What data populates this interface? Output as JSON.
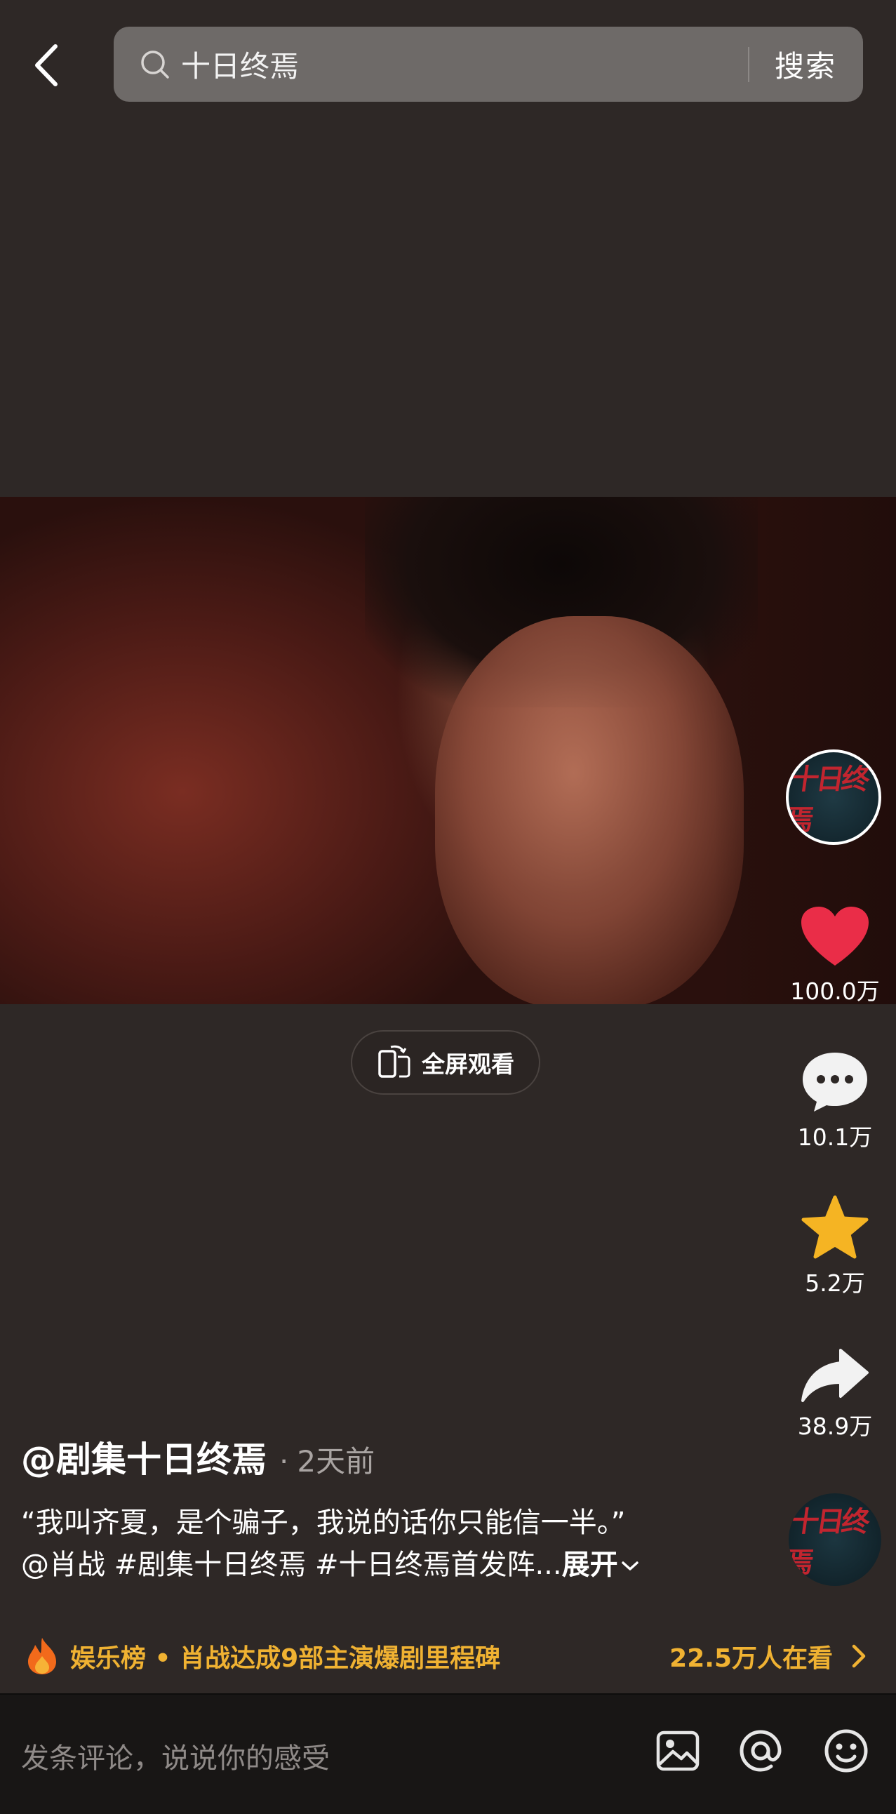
{
  "header": {
    "search_query": "十日终焉",
    "search_button": "搜索"
  },
  "actions": {
    "likes": "100.0万",
    "comments": "10.1万",
    "favorites": "5.2万",
    "shares": "38.9万"
  },
  "author_logo_text": "十日终焉",
  "fullscreen_label": "全屏观看",
  "post": {
    "author": "@剧集十日终焉",
    "separator": "·",
    "time_ago": "2天前",
    "caption_line1": "“我叫齐夏，是个骗子，我说的话你只能信一半。”",
    "caption_line2": "@肖战 #剧集十日终焉 #十日终焉首发阵...",
    "expand_label": "展开"
  },
  "hot": {
    "text": "娱乐榜 • 肖战达成9部主演爆剧里程碑",
    "watching": "22.5万人在看"
  },
  "comment_bar": {
    "placeholder": "发条评论，说说你的感受"
  },
  "colors": {
    "background": "#2e2826",
    "like": "#ea2d48",
    "favorite": "#f5b423",
    "hot": "#f0b232"
  }
}
